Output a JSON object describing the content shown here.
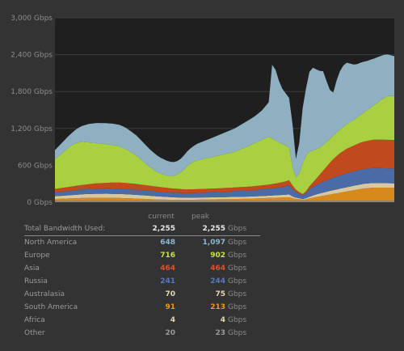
{
  "chart_data": {
    "type": "area",
    "stacked": true,
    "unit": "Gbps",
    "ylim": [
      0,
      3000
    ],
    "yticks": [
      "3,000 Gbps",
      "2,400 Gbps",
      "1,800 Gbps",
      "1,200 Gbps",
      "600 Gbps",
      "0 Gbps"
    ],
    "ytick_values": [
      3000,
      2400,
      1800,
      1200,
      600,
      0
    ],
    "x": [
      0,
      1,
      2,
      3,
      4,
      5,
      6,
      7,
      8,
      9,
      10,
      11,
      12,
      13,
      14,
      15,
      16,
      17,
      18,
      19,
      20,
      21,
      22,
      23,
      24,
      25,
      26,
      27,
      28,
      29,
      30,
      31,
      32,
      33,
      34,
      35,
      36,
      37,
      38,
      39,
      40,
      41,
      42,
      43,
      44,
      45,
      46,
      47,
      48,
      49,
      50,
      51,
      52,
      53,
      54,
      55,
      56,
      57,
      58,
      59,
      60,
      61,
      62,
      63,
      64,
      65,
      66,
      67,
      68,
      69,
      70,
      71,
      72,
      73,
      74,
      75,
      76,
      77,
      78,
      79,
      80,
      81,
      82,
      83,
      84,
      85,
      86,
      87,
      88,
      89,
      90,
      91,
      92,
      93,
      94,
      95,
      96,
      97,
      98,
      99,
      100
    ],
    "series": [
      {
        "name": "Other",
        "color": "#8a8a8a",
        "values": [
          20,
          20,
          20,
          20,
          20,
          20,
          20,
          20,
          20,
          20,
          20,
          20,
          20,
          20,
          20,
          20,
          20,
          20,
          20,
          20,
          20,
          20,
          20,
          20,
          20,
          20,
          20,
          20,
          20,
          20,
          20,
          20,
          20,
          20,
          20,
          20,
          20,
          20,
          20,
          20,
          20,
          20,
          20,
          20,
          20,
          20,
          20,
          20,
          20,
          20,
          20,
          20,
          20,
          20,
          20,
          20,
          20,
          20,
          20,
          20,
          20,
          20,
          20,
          20,
          20,
          20,
          20,
          20,
          20,
          20,
          20,
          20,
          20,
          20,
          20,
          20,
          20,
          20,
          20,
          20,
          20,
          20,
          20,
          20,
          20,
          20,
          20,
          20,
          20,
          20,
          20,
          20,
          20,
          20,
          20,
          20,
          20,
          20,
          20,
          20,
          20
        ]
      },
      {
        "name": "Africa",
        "color": "#c0a060",
        "values": [
          4,
          4,
          4,
          4,
          4,
          4,
          4,
          4,
          4,
          4,
          4,
          4,
          4,
          4,
          4,
          4,
          4,
          4,
          4,
          4,
          4,
          4,
          4,
          4,
          4,
          4,
          4,
          4,
          4,
          4,
          4,
          4,
          4,
          4,
          4,
          4,
          4,
          4,
          4,
          4,
          4,
          4,
          4,
          4,
          4,
          4,
          4,
          4,
          4,
          4,
          4,
          4,
          4,
          4,
          4,
          4,
          4,
          4,
          4,
          4,
          4,
          4,
          4,
          4,
          4,
          4,
          4,
          4,
          4,
          4,
          4,
          4,
          4,
          4,
          4,
          4,
          4,
          4,
          4,
          4,
          4,
          4,
          4,
          4,
          4,
          4,
          4,
          4,
          4,
          4,
          4,
          4,
          4,
          4,
          4,
          4,
          4,
          4,
          4,
          4,
          4
        ]
      },
      {
        "name": "South America",
        "color": "#d8891c",
        "values": [
          28,
          30,
          32,
          34,
          36,
          38,
          40,
          42,
          44,
          45,
          46,
          47,
          48,
          48,
          48,
          48,
          47,
          46,
          45,
          44,
          42,
          40,
          38,
          36,
          34,
          32,
          30,
          28,
          26,
          24,
          22,
          20,
          18,
          17,
          16,
          16,
          16,
          16,
          16,
          16,
          16,
          16,
          17,
          18,
          19,
          20,
          21,
          22,
          23,
          24,
          25,
          26,
          27,
          28,
          29,
          30,
          31,
          32,
          34,
          36,
          38,
          40,
          42,
          44,
          46,
          48,
          50,
          52,
          54,
          56,
          40,
          30,
          25,
          18,
          24,
          38,
          48,
          60,
          70,
          80,
          90,
          100,
          110,
          120,
          130,
          140,
          150,
          160,
          170,
          180,
          190,
          200,
          205,
          210,
          213,
          213,
          213,
          213,
          213,
          213,
          213
        ]
      },
      {
        "name": "Australasia",
        "color": "#d8c8a0",
        "values": [
          45,
          46,
          48,
          50,
          52,
          54,
          56,
          58,
          60,
          62,
          63,
          64,
          65,
          65,
          65,
          66,
          66,
          66,
          66,
          66,
          66,
          65,
          64,
          63,
          62,
          60,
          58,
          56,
          54,
          52,
          50,
          48,
          46,
          44,
          42,
          40,
          38,
          36,
          35,
          34,
          34,
          34,
          34,
          34,
          34,
          34,
          34,
          34,
          34,
          34,
          34,
          34,
          34,
          34,
          34,
          34,
          34,
          35,
          35,
          36,
          36,
          37,
          37,
          38,
          39,
          40,
          41,
          42,
          44,
          46,
          30,
          20,
          15,
          10,
          18,
          28,
          36,
          42,
          48,
          52,
          56,
          60,
          62,
          64,
          66,
          68,
          70,
          71,
          72,
          73,
          74,
          75,
          75,
          75,
          75,
          75,
          74,
          73,
          72,
          71,
          70
        ]
      },
      {
        "name": "Russia",
        "color": "#4a6aa8",
        "values": [
          60,
          62,
          64,
          66,
          68,
          70,
          72,
          74,
          76,
          78,
          80,
          82,
          84,
          85,
          86,
          87,
          88,
          88,
          88,
          88,
          88,
          87,
          86,
          85,
          84,
          83,
          82,
          81,
          80,
          79,
          78,
          77,
          76,
          75,
          74,
          73,
          72,
          72,
          72,
          72,
          73,
          74,
          75,
          76,
          77,
          78,
          79,
          80,
          82,
          84,
          86,
          88,
          90,
          92,
          94,
          96,
          98,
          100,
          102,
          104,
          106,
          108,
          110,
          112,
          116,
          120,
          126,
          132,
          140,
          150,
          120,
          90,
          70,
          60,
          80,
          120,
          140,
          155,
          165,
          175,
          185,
          195,
          205,
          212,
          218,
          222,
          226,
          230,
          234,
          238,
          240,
          242,
          243,
          244,
          244,
          244,
          244,
          243,
          242,
          241,
          241
        ]
      },
      {
        "name": "Asia",
        "color": "#c04a1c",
        "values": [
          60,
          62,
          64,
          66,
          68,
          70,
          72,
          74,
          76,
          78,
          80,
          82,
          84,
          86,
          88,
          90,
          92,
          94,
          95,
          96,
          96,
          96,
          95,
          94,
          92,
          90,
          88,
          86,
          84,
          82,
          80,
          78,
          76,
          74,
          72,
          70,
          68,
          66,
          64,
          62,
          62,
          62,
          62,
          62,
          62,
          62,
          62,
          62,
          62,
          62,
          62,
          62,
          62,
          62,
          62,
          62,
          62,
          62,
          62,
          63,
          64,
          65,
          66,
          68,
          70,
          72,
          74,
          76,
          78,
          80,
          60,
          40,
          30,
          20,
          30,
          50,
          70,
          100,
          140,
          180,
          220,
          260,
          300,
          330,
          360,
          380,
          400,
          410,
          420,
          430,
          440,
          445,
          450,
          455,
          460,
          462,
          464,
          464,
          464,
          464,
          464
        ]
      },
      {
        "name": "Europe",
        "color": "#a8d040",
        "values": [
          480,
          520,
          560,
          600,
          640,
          670,
          690,
          700,
          700,
          690,
          680,
          670,
          660,
          650,
          640,
          630,
          620,
          610,
          600,
          590,
          570,
          550,
          520,
          490,
          460,
          420,
          380,
          340,
          300,
          270,
          240,
          220,
          210,
          200,
          200,
          210,
          230,
          270,
          320,
          380,
          420,
          450,
          470,
          480,
          490,
          500,
          510,
          520,
          530,
          540,
          550,
          560,
          570,
          580,
          600,
          620,
          640,
          660,
          680,
          700,
          720,
          740,
          760,
          780,
          740,
          700,
          660,
          620,
          580,
          540,
          300,
          200,
          300,
          500,
          580,
          560,
          520,
          480,
          440,
          420,
          400,
          390,
          380,
          380,
          385,
          390,
          400,
          410,
          420,
          430,
          450,
          470,
          500,
          530,
          560,
          600,
          640,
          680,
          710,
          716,
          716
        ]
      },
      {
        "name": "North America",
        "color": "#8eb0c0",
        "values": [
          150,
          160,
          170,
          180,
          190,
          200,
          220,
          240,
          260,
          280,
          300,
          310,
          320,
          330,
          335,
          340,
          345,
          350,
          350,
          350,
          350,
          345,
          340,
          335,
          330,
          320,
          310,
          300,
          290,
          280,
          270,
          260,
          250,
          240,
          230,
          220,
          220,
          220,
          230,
          240,
          250,
          260,
          270,
          280,
          290,
          300,
          310,
          320,
          330,
          340,
          350,
          360,
          370,
          380,
          390,
          400,
          410,
          420,
          430,
          440,
          460,
          480,
          520,
          560,
          1200,
          1150,
          1000,
          900,
          850,
          800,
          700,
          300,
          500,
          900,
          1100,
          1300,
          1350,
          1300,
          1250,
          1200,
          1000,
          800,
          700,
          850,
          950,
          1000,
          1000,
          950,
          900,
          870,
          850,
          830,
          800,
          780,
          760,
          740,
          720,
          700,
          680,
          660,
          648
        ]
      }
    ]
  },
  "table": {
    "header": {
      "current": "current",
      "peak": "peak"
    },
    "total": {
      "label": "Total Bandwidth Used:",
      "current": "2,255",
      "peak": "2,255",
      "unit": "Gbps"
    },
    "rows": [
      {
        "label": "North America",
        "current": "648",
        "peak": "1,097",
        "unit": "Gbps",
        "color": "#8ab8d0"
      },
      {
        "label": "Europe",
        "current": "716",
        "peak": "902",
        "unit": "Gbps",
        "color": "#c8e050"
      },
      {
        "label": "Asia",
        "current": "464",
        "peak": "464",
        "unit": "Gbps",
        "color": "#e0502a"
      },
      {
        "label": "Russia",
        "current": "241",
        "peak": "244",
        "unit": "Gbps",
        "color": "#5878c0"
      },
      {
        "label": "Australasia",
        "current": "70",
        "peak": "75",
        "unit": "Gbps",
        "color": "#e8d8b0"
      },
      {
        "label": "South America",
        "current": "91",
        "peak": "213",
        "unit": "Gbps",
        "color": "#e89a2a"
      },
      {
        "label": "Africa",
        "current": "4",
        "peak": "4",
        "unit": "Gbps",
        "color": "#e8d8b0"
      },
      {
        "label": "Other",
        "current": "20",
        "peak": "23",
        "unit": "Gbps",
        "color": "#9a9a9a"
      }
    ]
  }
}
